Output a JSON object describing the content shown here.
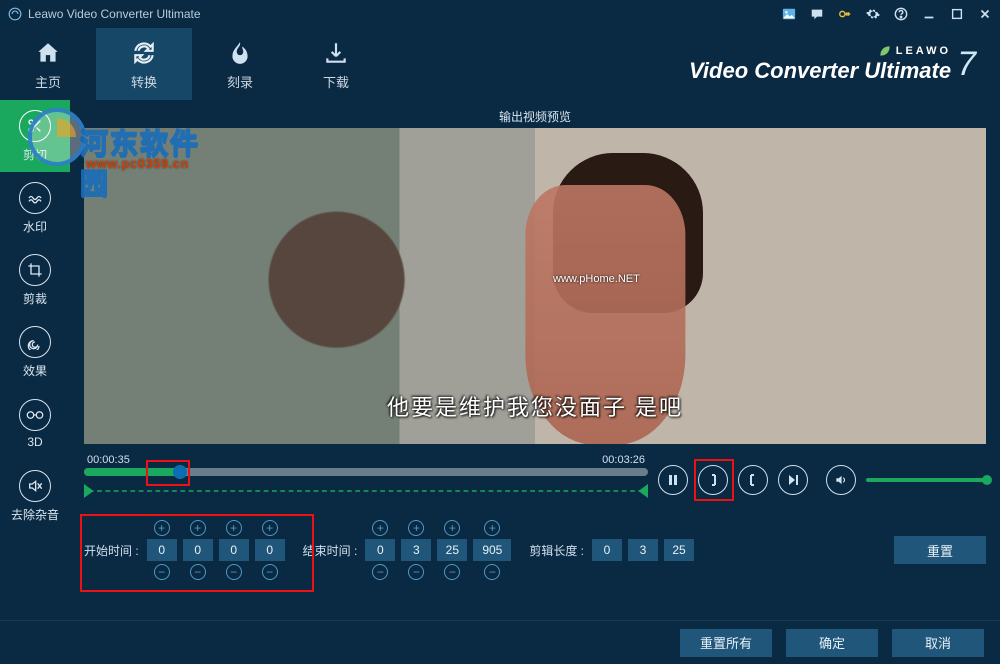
{
  "app": {
    "title": "Leawo Video Converter Ultimate"
  },
  "brand": {
    "leawo": "LEAWO",
    "main": "Video Converter Ultimate",
    "ver": "7"
  },
  "nav": {
    "home": "主页",
    "convert": "转换",
    "burn": "刻录",
    "download": "下载"
  },
  "tools": {
    "trim": "剪切",
    "watermark": "水印",
    "crop": "剪裁",
    "effect": "效果",
    "d3": "3D",
    "denoise": "去除杂音"
  },
  "preview": {
    "title": "输出视频预览",
    "subtitle": "他要是维护我您没面子 是吧",
    "wm_url": "www.pHome.NET"
  },
  "overlay": {
    "cn": "河东软件园",
    "url": "www.pc0359.cn"
  },
  "timeline": {
    "left": "00:00:35",
    "right": "00:03:26",
    "progress_pct": 17
  },
  "start": {
    "label": "开始时间 :",
    "h": "0",
    "m": "0",
    "s": "0",
    "ms": "0"
  },
  "end": {
    "label": "结束时间 :",
    "h": "0",
    "m": "3",
    "s": "25",
    "ms": "905"
  },
  "length": {
    "label": "剪辑长度 :",
    "h": "0",
    "m": "3",
    "s": "25"
  },
  "buttons": {
    "reset": "重置",
    "reset_all": "重置所有",
    "ok": "确定",
    "cancel": "取消"
  }
}
